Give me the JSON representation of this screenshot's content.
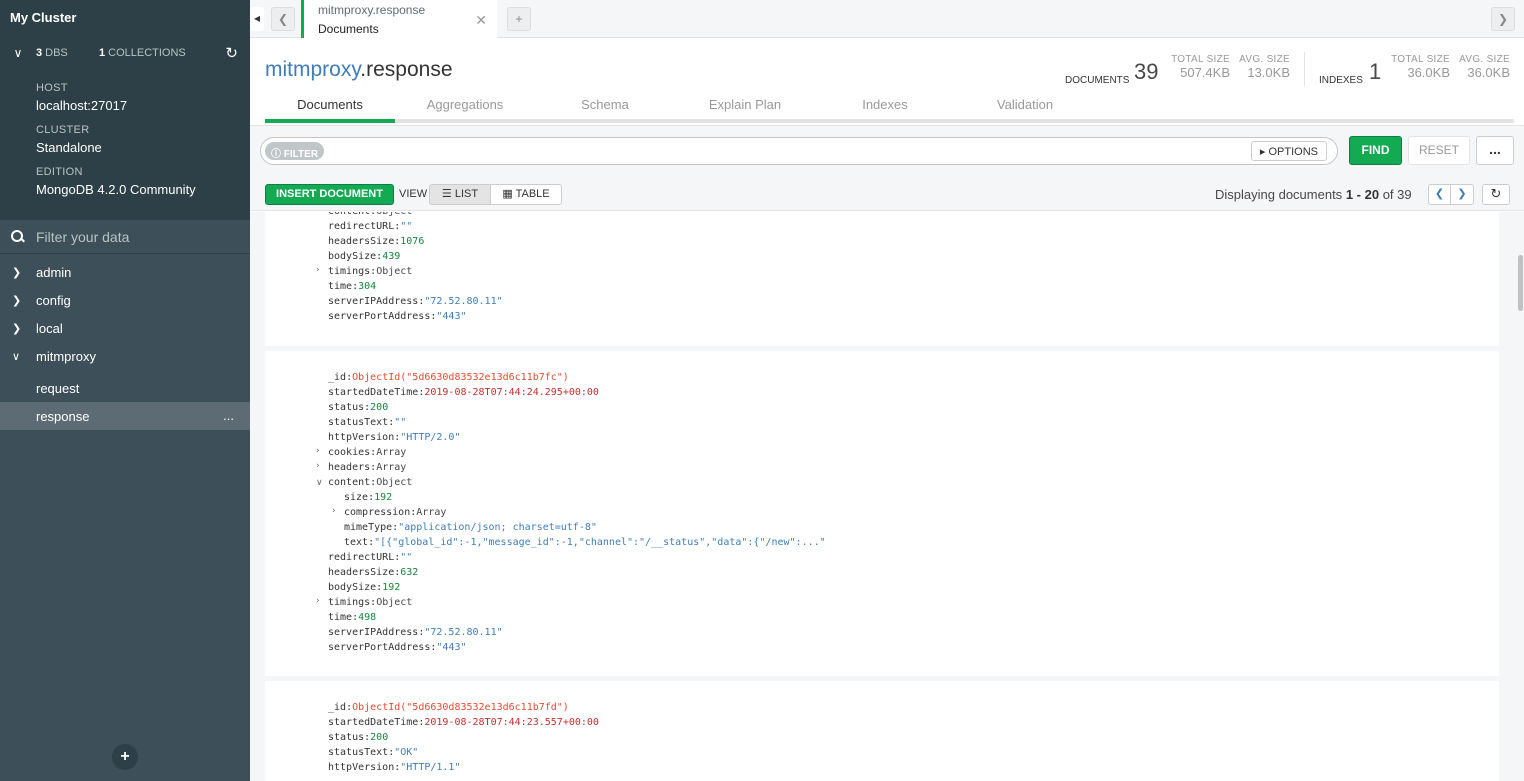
{
  "sidebar": {
    "title": "My Cluster",
    "dbs_count": "3",
    "dbs_label": "DBS",
    "collections_count": "1",
    "collections_label": "COLLECTIONS",
    "host_label": "HOST",
    "host_value": "localhost:27017",
    "cluster_label": "CLUSTER",
    "cluster_value": "Standalone",
    "edition_label": "EDITION",
    "edition_value": "MongoDB 4.2.0 Community",
    "filter_placeholder": "Filter your data",
    "databases": [
      "admin",
      "config",
      "local",
      "mitmproxy"
    ],
    "collections": [
      "request",
      "response"
    ],
    "active_more": "..."
  },
  "tab": {
    "namespace": "mitmproxy.response",
    "subtitle": "Documents"
  },
  "header": {
    "db": "mitmproxy",
    "coll": ".response",
    "documents_label": "DOCUMENTS",
    "documents_count": "39",
    "total_size_label": "TOTAL SIZE",
    "total_size": "507.4KB",
    "avg_size_label": "AVG. SIZE",
    "avg_size": "13.0KB",
    "indexes_label": "INDEXES",
    "indexes_count": "1",
    "idx_total_size_label": "TOTAL SIZE",
    "idx_total_size": "36.0KB",
    "idx_avg_size_label": "AVG. SIZE",
    "idx_avg_size": "36.0KB"
  },
  "subtabs": [
    "Documents",
    "Aggregations",
    "Schema",
    "Explain Plan",
    "Indexes",
    "Validation"
  ],
  "querybar": {
    "filter_label": "FILTER",
    "options_label": "OPTIONS",
    "find_label": "FIND",
    "reset_label": "RESET",
    "more_label": "..."
  },
  "toolbar": {
    "insert_label": "INSERT DOCUMENT",
    "view_label": "VIEW",
    "list_label": "LIST",
    "table_label": "TABLE",
    "paging_prefix": "Displaying documents",
    "paging_range": "1 - 20",
    "paging_of": "of 39"
  },
  "docs": [
    {
      "fields": [
        {
          "caret": ">",
          "key": "content",
          "type": "obj",
          "value": "Object"
        },
        {
          "key": "redirectURL",
          "type": "str",
          "value": "\"\""
        },
        {
          "key": "headersSize",
          "type": "num",
          "value": "1076"
        },
        {
          "key": "bodySize",
          "type": "num",
          "value": "439"
        },
        {
          "caret": ">",
          "key": "timings",
          "type": "obj",
          "value": "Object"
        },
        {
          "key": "time",
          "type": "num",
          "value": "304"
        },
        {
          "key": "serverIPAddress",
          "type": "str",
          "value": "\"72.52.80.11\""
        },
        {
          "key": "serverPortAddress",
          "type": "str",
          "value": "\"443\""
        }
      ]
    },
    {
      "fields": [
        {
          "key": "_id",
          "type": "oid",
          "value": "ObjectId(\"5d6630d83532e13d6c11b7fc\")"
        },
        {
          "key": "startedDateTime",
          "type": "date",
          "value": "2019-08-28T07:44:24.295+00:00"
        },
        {
          "key": "status",
          "type": "num",
          "value": "200"
        },
        {
          "key": "statusText",
          "type": "str",
          "value": "\"\""
        },
        {
          "key": "httpVersion",
          "type": "str",
          "value": "\"HTTP/2.0\""
        },
        {
          "caret": ">",
          "key": "cookies",
          "type": "obj",
          "value": "Array"
        },
        {
          "caret": ">",
          "key": "headers",
          "type": "obj",
          "value": "Array"
        },
        {
          "caret": "v",
          "key": "content",
          "type": "obj",
          "value": "Object"
        },
        {
          "indent": 1,
          "key": "size",
          "type": "num",
          "value": "192"
        },
        {
          "indent": 1,
          "caret": ">",
          "key": "compression",
          "type": "obj",
          "value": "Array"
        },
        {
          "indent": 1,
          "key": "mimeType",
          "type": "str",
          "value": "\"application/json; charset=utf-8\""
        },
        {
          "indent": 1,
          "key": "text",
          "type": "str",
          "value": "\"[{\"global_id\":-1,\"message_id\":-1,\"channel\":\"/__status\",\"data\":{\"/new\":...\""
        },
        {
          "key": "redirectURL",
          "type": "str",
          "value": "\"\""
        },
        {
          "key": "headersSize",
          "type": "num",
          "value": "632"
        },
        {
          "key": "bodySize",
          "type": "num",
          "value": "192"
        },
        {
          "caret": ">",
          "key": "timings",
          "type": "obj",
          "value": "Object"
        },
        {
          "key": "time",
          "type": "num",
          "value": "498"
        },
        {
          "key": "serverIPAddress",
          "type": "str",
          "value": "\"72.52.80.11\""
        },
        {
          "key": "serverPortAddress",
          "type": "str",
          "value": "\"443\""
        }
      ]
    },
    {
      "fields": [
        {
          "key": "_id",
          "type": "oid",
          "value": "ObjectId(\"5d6630d83532e13d6c11b7fd\")"
        },
        {
          "key": "startedDateTime",
          "type": "date",
          "value": "2019-08-28T07:44:23.557+00:00"
        },
        {
          "key": "status",
          "type": "num",
          "value": "200"
        },
        {
          "key": "statusText",
          "type": "str",
          "value": "\"OK\""
        },
        {
          "key": "httpVersion",
          "type": "str",
          "value": "\"HTTP/1.1\""
        }
      ]
    }
  ]
}
